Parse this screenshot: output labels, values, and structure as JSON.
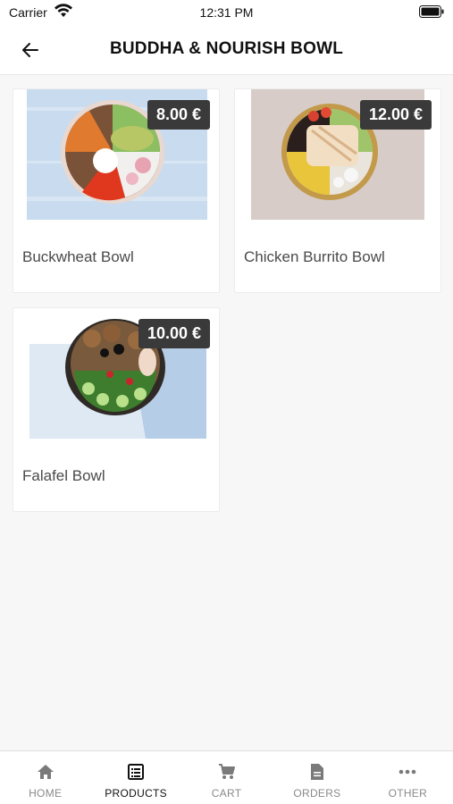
{
  "status": {
    "carrier": "Carrier",
    "time": "12:31 PM"
  },
  "header": {
    "title": "BUDDHA & NOURISH BOWL",
    "back_icon": "arrow-left-icon"
  },
  "products": [
    {
      "name": "Buckwheat Bowl",
      "price": "8.00 €"
    },
    {
      "name": "Chicken Burrito Bowl",
      "price": "12.00 €"
    },
    {
      "name": "Falafel Bowl",
      "price": "10.00 €"
    }
  ],
  "nav": {
    "items": [
      {
        "label": "HOME",
        "icon": "home-icon"
      },
      {
        "label": "PRODUCTS",
        "icon": "products-icon",
        "active": true
      },
      {
        "label": "CART",
        "icon": "cart-icon"
      },
      {
        "label": "ORDERS",
        "icon": "orders-icon"
      },
      {
        "label": "OTHER",
        "icon": "more-icon"
      }
    ]
  }
}
